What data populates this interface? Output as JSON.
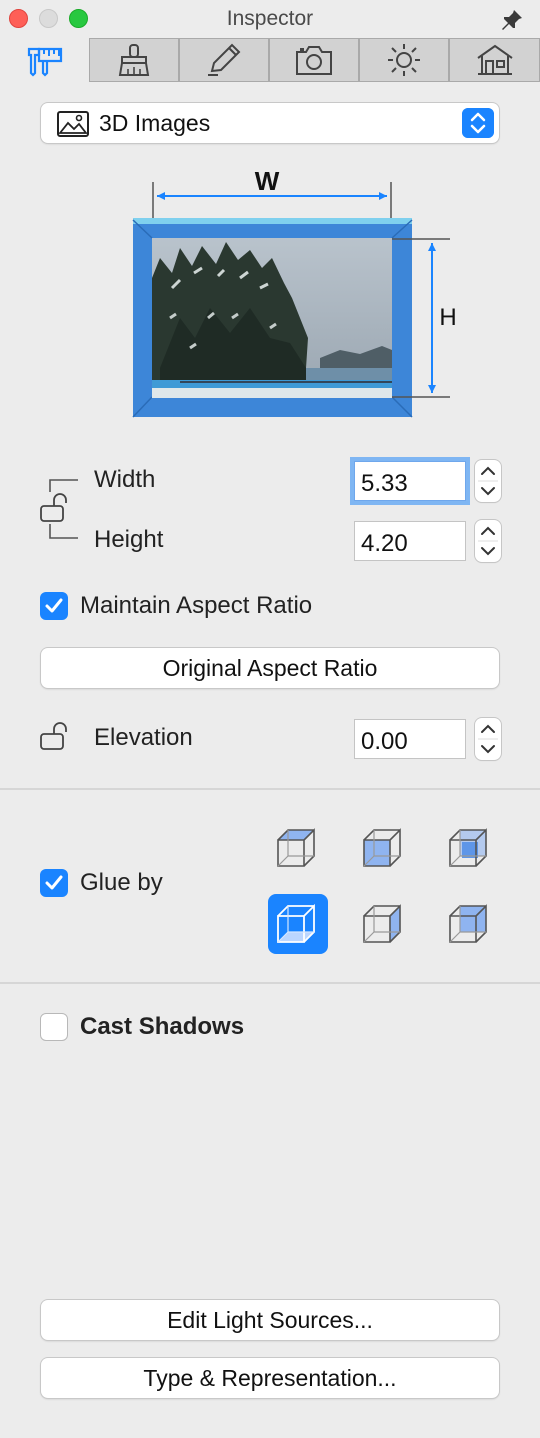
{
  "window": {
    "title": "Inspector",
    "pin_icon": "pin-icon"
  },
  "tabs": [
    {
      "id": "dimensions",
      "icon": "caliper-ruler-icon",
      "active": true
    },
    {
      "id": "appearance",
      "icon": "brush-icon",
      "active": false
    },
    {
      "id": "edit",
      "icon": "pencil-icon",
      "active": false
    },
    {
      "id": "camera",
      "icon": "camera-icon",
      "active": false
    },
    {
      "id": "light",
      "icon": "sun-icon",
      "active": false
    },
    {
      "id": "building",
      "icon": "house-icon",
      "active": false
    }
  ],
  "type_selector": {
    "icon": "image-icon",
    "value": "3D Images"
  },
  "diagram": {
    "width_marker": "W",
    "height_marker": "H",
    "photo": "snowy pine trees by a lake"
  },
  "dimensions": {
    "width_label": "Width",
    "width_value": "5.33",
    "height_label": "Height",
    "height_value": "4.20"
  },
  "maintain_aspect": {
    "label": "Maintain Aspect Ratio",
    "checked": true
  },
  "original_aspect_button": "Original Aspect Ratio",
  "elevation": {
    "label": "Elevation",
    "value": "0.00"
  },
  "glue": {
    "label": "Glue by",
    "checked": true,
    "options": [
      {
        "name": "glue-top-face",
        "selected": false
      },
      {
        "name": "glue-front-face",
        "selected": false
      },
      {
        "name": "glue-right-face",
        "selected": false
      },
      {
        "name": "glue-center",
        "selected": true
      },
      {
        "name": "glue-side-face",
        "selected": false
      },
      {
        "name": "glue-back-face",
        "selected": false
      }
    ]
  },
  "cast_shadows": {
    "label": "Cast Shadows",
    "checked": false
  },
  "buttons": {
    "edit_light_sources": "Edit Light Sources...",
    "type_representation": "Type & Representation..."
  },
  "colors": {
    "accent": "#1a84ff",
    "frame_blue": "#3d86d8",
    "frame_light": "#7fb7ee"
  }
}
